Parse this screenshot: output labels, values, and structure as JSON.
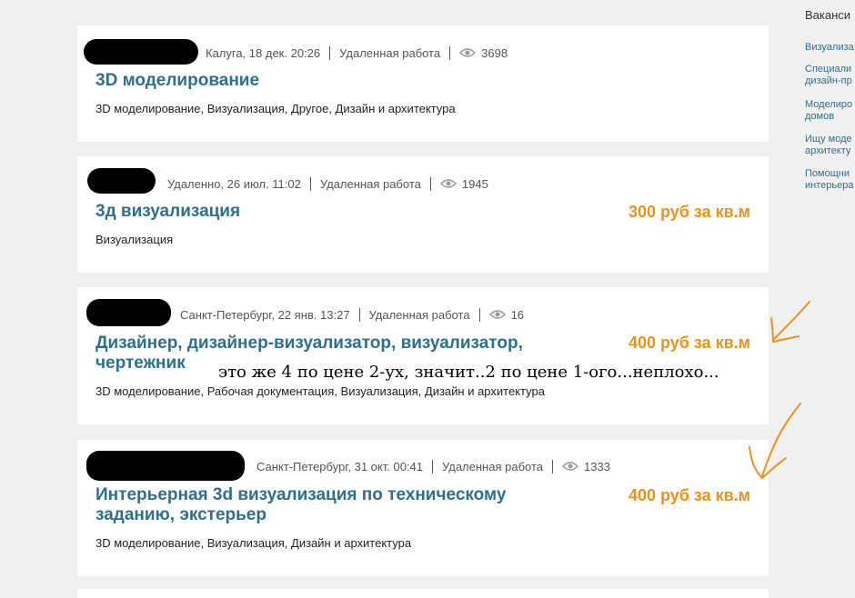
{
  "sidebar": {
    "heading": "Ваканси",
    "items": [
      "Визуализа",
      "Специали дизайн-пр",
      "Моделиро домов",
      "Ищу моде архитекту",
      "Помощни интерьера"
    ]
  },
  "listings": [
    {
      "location_time": "Калуга, 18 дек. 20:26",
      "work_type": "Удаленная работа",
      "views": "3698",
      "title": "3D моделирование",
      "price": "",
      "tags": "3D моделирование, Визуализация, Другое, Дизайн и архитектура"
    },
    {
      "location_time": "Удаленно, 26 июл. 11:02",
      "work_type": "Удаленная работа",
      "views": "1945",
      "title": "3д визуализация",
      "price": "300 руб за кв.м",
      "tags": "Визуализация"
    },
    {
      "location_time": "Санкт-Петербург, 22 янв. 13:27",
      "work_type": "Удаленная работа",
      "views": "16",
      "title": "Дизайнер, дизайнер-визуализатор, визуализатор, чертежник",
      "price": "400 руб за кв.м",
      "tags": "3D моделирование, Рабочая документация, Визуализация, Дизайн и архитектура"
    },
    {
      "location_time": "Санкт-Петербург, 31 окт. 00:41",
      "work_type": "Удаленная работа",
      "views": "1333",
      "title": "Интерьерная 3d визуализация по техническому заданию, экстерьер",
      "price": "400 руб за кв.м",
      "tags": "3D моделирование, Визуализация, Дизайн и архитектура"
    }
  ],
  "annotation": {
    "text": "это же 4 по цене 2-ух, значит..2 по цене 1-ого...неплохо...",
    "color": "#e8921c"
  },
  "icons": {
    "views": "eye-icon"
  },
  "colors": {
    "title": "#2e6f8e",
    "price": "#e8921c",
    "background": "#f0f0f0"
  }
}
